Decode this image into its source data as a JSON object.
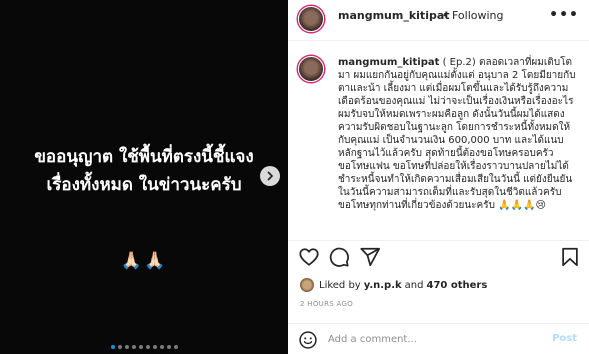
{
  "media": {
    "line1": "ขออนุญาต ใช้พื้นที่ตรงนี้ชี้แจง",
    "line2": "เรื่องทั้งหมด ในข่าวนะครับ",
    "emoji": "🙏🏻🙏🏻",
    "carousel_total": 10,
    "carousel_active": 0
  },
  "header": {
    "username": "mangmum_kitipat",
    "separator": "•",
    "follow_state": "Following",
    "more": "•••"
  },
  "caption": {
    "username": "mangmum_kitipat",
    "text": "( Ep.2) ตลอดเวลาที่ผมเติบโตมา ผมแยกกันอยู่กับคุณแม่ตั้งแต่ อนุบาล 2 โดยมียายกับตาและน้า เลี้ยงมา แต่เมื่อผมโตขึ้นและได้รับรู้ถึงความเดือดร้อนของคุณแม่ ไม่ว่าจะเป็นเรื่องเงินหรือเรื่องอะไร ผมรับจบให้หมดเพราะผมคือลูก ดังนั้นวันนี้ผมได้แสดงความรับผิดชอบในฐานะลูก โดยการชำระหนี้ทั้งหมดให้กับคุณแม่ เป็นจำนวนเงิน 600,000 บาท และได้แนบหลักฐานไว้แล้วครับ สุดท้ายนี้ต้องขอโทษครอบครัว ขอโทษแฟน ขอโทษที่ปล่อยให้เรื่องราวบานปลายไม่ได้ชำระหนี้จนทำให้เกิดความเสื่อมเสียในวันนี้ แต่ยังยืนยันในวันนี้ความสามารถเต็มที่และรับสุดในชีวิตแล้วครับ ขอโทษทุกท่านที่เกี่ยวข้องด้วยนะครับ 🙏🙏🙏😢"
  },
  "actions": {
    "like": "heart-icon",
    "comment": "comment-icon",
    "share": "share-icon",
    "save": "bookmark-icon"
  },
  "likes": {
    "prefix": "Liked by",
    "liker": "y.n.p.k",
    "and": "and",
    "others": "470 others"
  },
  "timestamp": "2 HOURS AGO",
  "comment_box": {
    "placeholder": "Add a comment...",
    "post_label": "Post"
  },
  "colors": {
    "media_bg": "#080808",
    "accent": "#0095f6",
    "post_disabled": "#b3dbff",
    "muted": "#8e8e8e"
  }
}
